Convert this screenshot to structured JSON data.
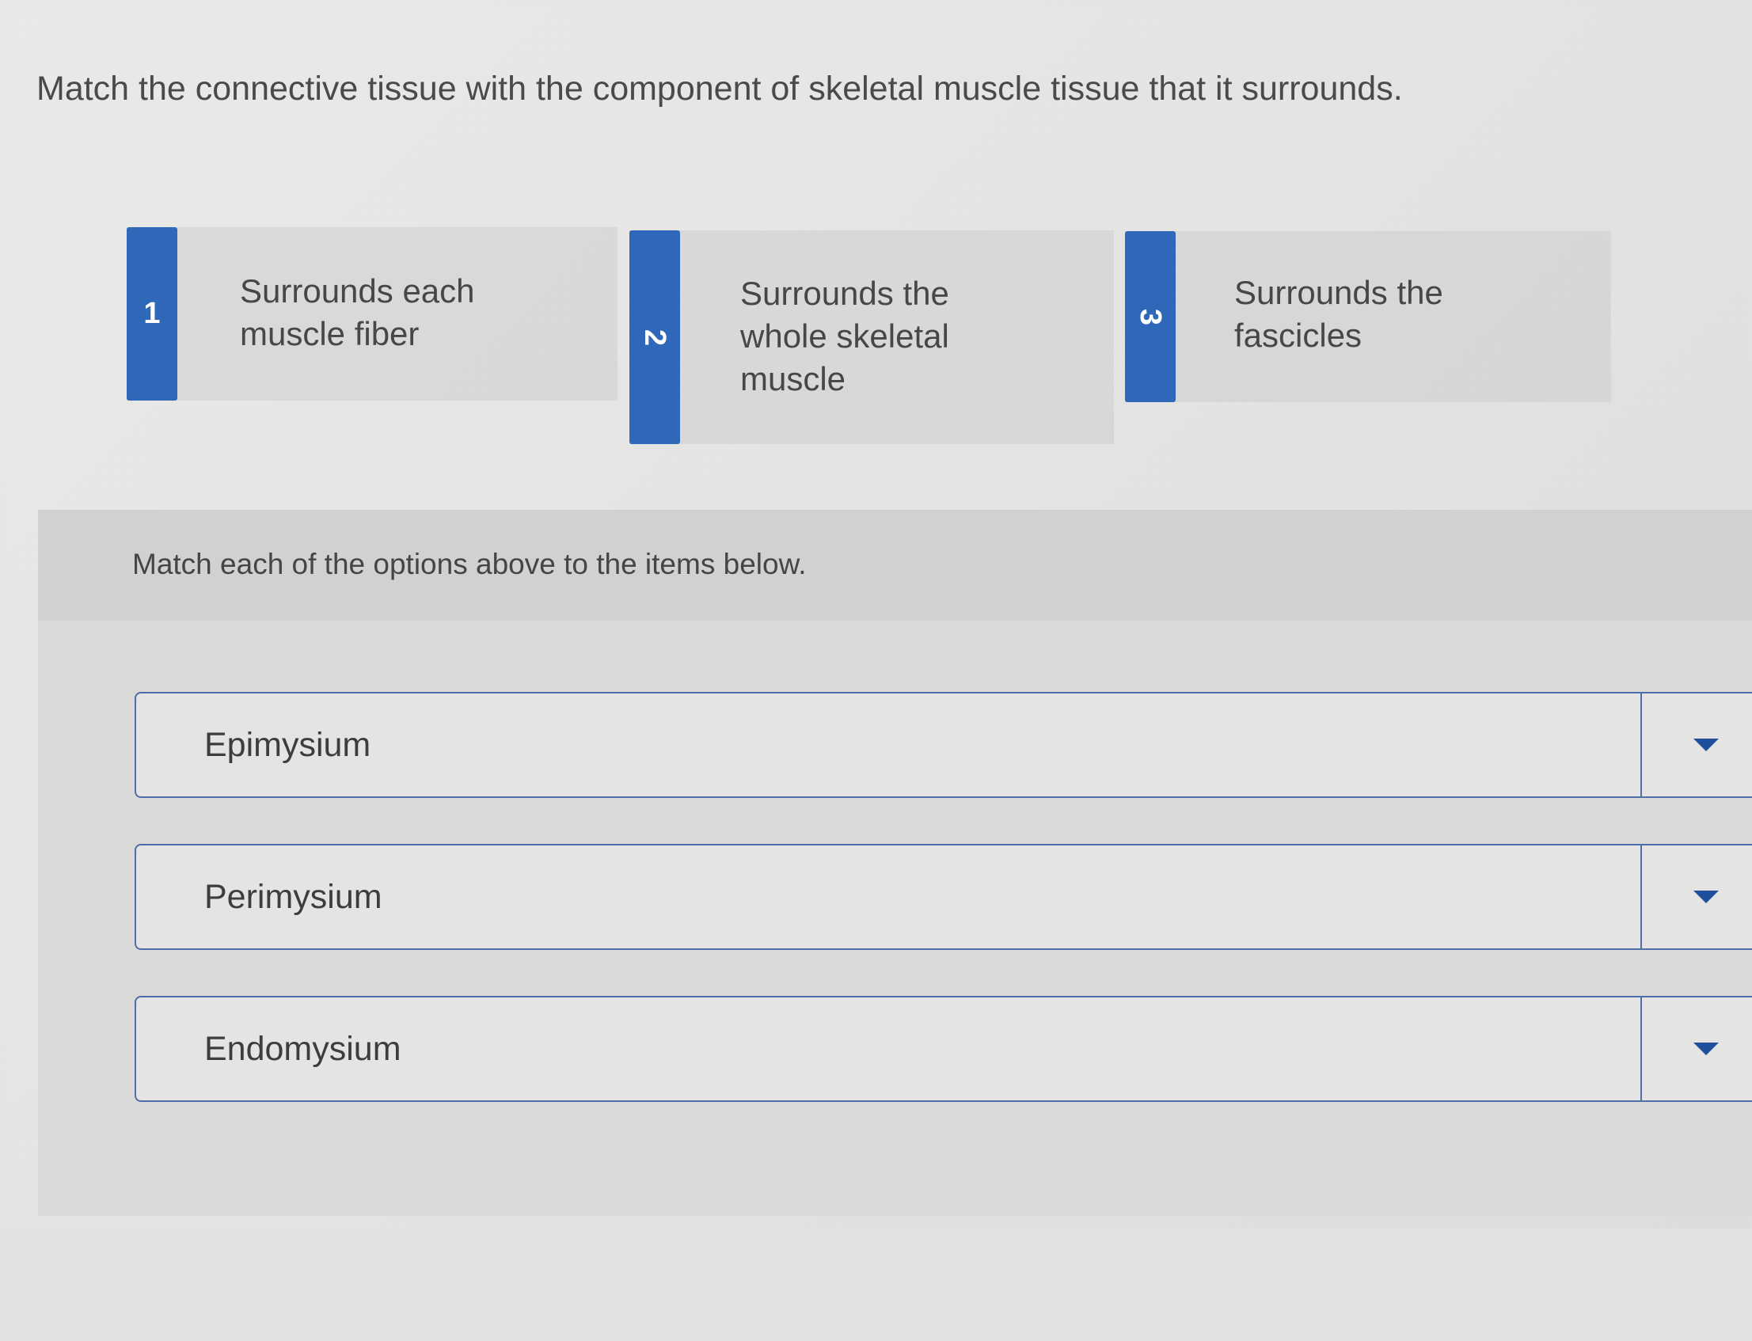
{
  "question": "Match the connective tissue with the component of skeletal muscle tissue that it surrounds.",
  "colors": {
    "tab_blue": "#2f68b8",
    "row_border": "#4e6ea8",
    "caret": "#1f4f9a"
  },
  "options": [
    {
      "number": "1",
      "text": "Surrounds each muscle fiber"
    },
    {
      "number": "2",
      "text": "Surrounds the whole skeletal muscle"
    },
    {
      "number": "3",
      "text": "Surrounds the fascicles"
    }
  ],
  "instruction": "Match each of the options above to the items below.",
  "items": [
    {
      "label": "Epimysium",
      "dropdown_icon": "caret-down-icon"
    },
    {
      "label": "Perimysium",
      "dropdown_icon": "caret-down-icon"
    },
    {
      "label": "Endomysium",
      "dropdown_icon": "caret-down-icon"
    }
  ]
}
